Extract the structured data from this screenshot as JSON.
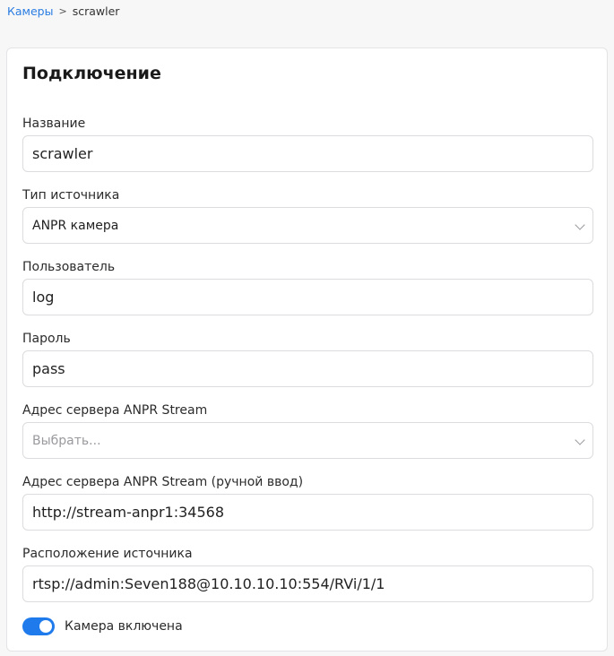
{
  "breadcrumb": {
    "parent": "Камеры",
    "separator": ">",
    "current": "scrawler"
  },
  "card": {
    "title": "Подключение"
  },
  "fields": {
    "name": {
      "label": "Название",
      "value": "scrawler"
    },
    "source_type": {
      "label": "Тип источника",
      "value": "ANPR камера"
    },
    "user": {
      "label": "Пользователь",
      "value": "log"
    },
    "password": {
      "label": "Пароль",
      "value": "pass"
    },
    "anpr_server": {
      "label": "Адрес сервера ANPR Stream",
      "placeholder": "Выбрать..."
    },
    "anpr_server_manual": {
      "label": "Адрес сервера ANPR Stream (ручной ввод)",
      "value": "http://stream-anpr1:34568"
    },
    "source_location": {
      "label": "Расположение источника",
      "value": "rtsp://admin:Seven188@10.10.10.10:554/RVi/1/1"
    }
  },
  "toggle": {
    "label": "Камера включена",
    "enabled": true,
    "accent_color": "#1f7aec"
  }
}
